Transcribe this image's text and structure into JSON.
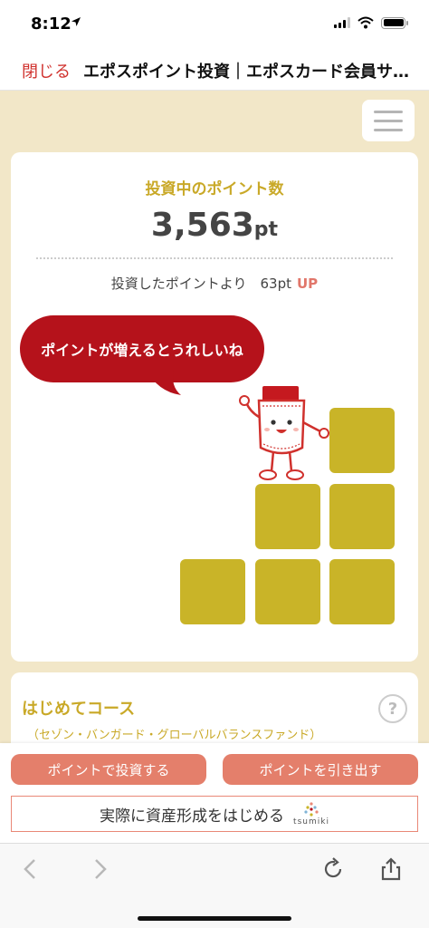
{
  "status_bar": {
    "time": "8:12"
  },
  "nav": {
    "close_label": "閉じる",
    "title": "エポスポイント投資｜エポスカード会員サ…"
  },
  "card": {
    "title": "投資中のポイント数",
    "points": "3,563",
    "points_unit": "pt",
    "diff_label": "投資したポイントより　63pt",
    "diff_direction": "UP",
    "speech": "ポイントが増えるとうれしいね"
  },
  "course": {
    "title": "はじめてコース",
    "subtitle": "（セゾン・バンガード・グローバルバランスファンド）"
  },
  "actions": {
    "invest_label": "ポイントで投資する",
    "withdraw_label": "ポイントを引き出す",
    "tsumiki_text": "実際に資産形成をはじめる",
    "tsumiki_logo": "tsumiki"
  },
  "colors": {
    "accent_gold": "#c9a928",
    "block_gold": "#c9b428",
    "speech_red": "#b5121b",
    "button_coral": "#e47f6b",
    "background_beige": "#f2e7c8"
  },
  "icons": [
    "location-arrow-icon",
    "signal-icon",
    "wifi-icon",
    "battery-icon",
    "menu-icon",
    "help-icon",
    "back-icon",
    "forward-icon",
    "reload-icon",
    "share-icon"
  ]
}
